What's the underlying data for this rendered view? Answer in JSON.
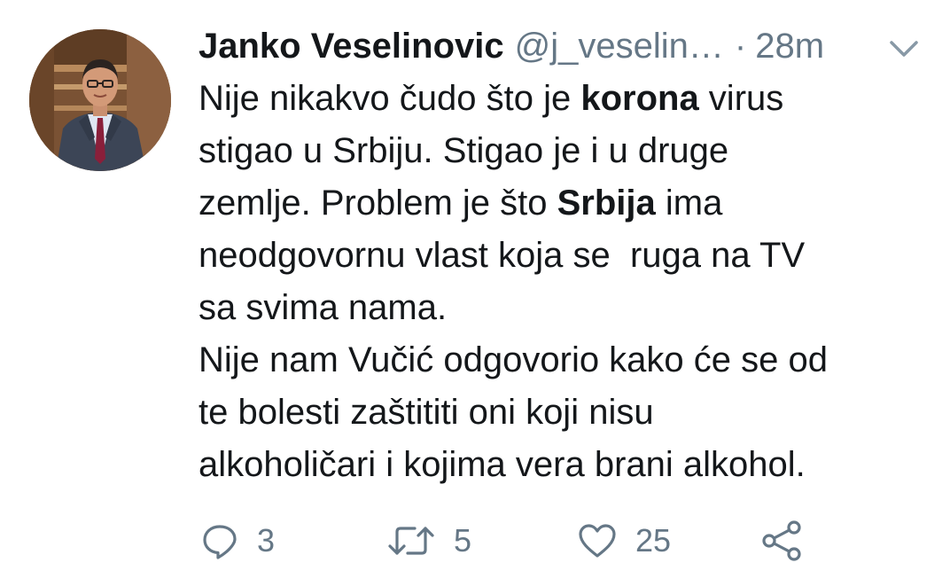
{
  "author": {
    "name": "Janko Veselinovic",
    "handle": "@j_veselin…",
    "separator": "·",
    "time": "28m"
  },
  "tweet": {
    "lines": [
      [
        "Nije nikakvo čudo što je ",
        "korona",
        " virus"
      ],
      [
        "stigao u Srbiju. Stigao je i u druge"
      ],
      [
        "zemlje. Problem je što ",
        "Srbija",
        " ima"
      ],
      [
        "neodgovornu vlast koja se  ruga na TV"
      ],
      [
        "sa svima nama."
      ],
      [
        "Nije nam Vučić odgovorio kako će se od"
      ],
      [
        "te bolesti zaštititi oni koji nisu"
      ],
      [
        "alkoholičari i kojima vera brani alkohol."
      ]
    ]
  },
  "actions": {
    "reply_count": "3",
    "retweet_count": "5",
    "like_count": "25"
  },
  "icons": {
    "reply": "reply-icon",
    "retweet": "retweet-icon",
    "like": "heart-icon",
    "share": "share-icon",
    "menu": "chevron-down-icon"
  },
  "colors": {
    "text": "#14171a",
    "secondary": "#657786",
    "background": "#ffffff"
  }
}
